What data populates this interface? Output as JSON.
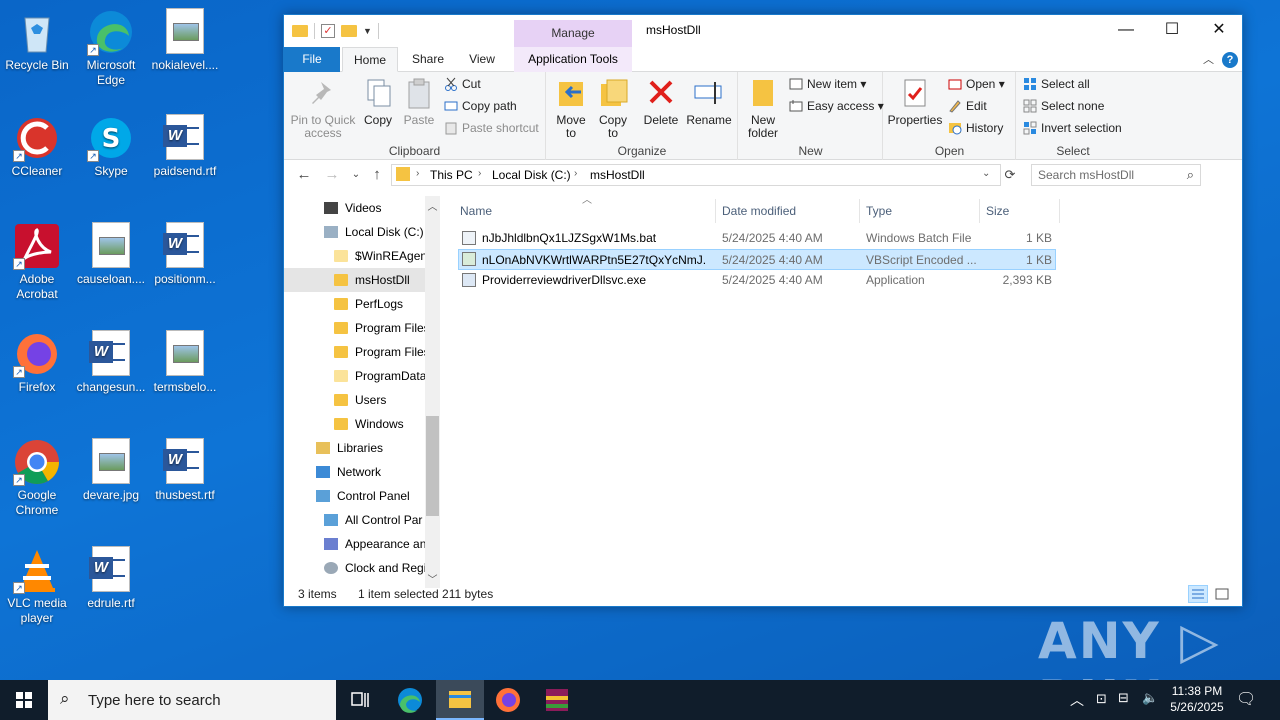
{
  "desktop": {
    "icons": [
      {
        "label": "Recycle Bin",
        "icon": "recycle-bin-icon"
      },
      {
        "label": "Microsoft Edge",
        "icon": "edge-icon"
      },
      {
        "label": "nokialevel....",
        "icon": "image-file-icon"
      },
      {
        "label": "CCleaner",
        "icon": "ccleaner-icon"
      },
      {
        "label": "Skype",
        "icon": "skype-icon"
      },
      {
        "label": "paidsend.rtf",
        "icon": "word-file-icon"
      },
      {
        "label": "Adobe Acrobat",
        "icon": "acrobat-icon"
      },
      {
        "label": "causeloan....",
        "icon": "image-file-icon"
      },
      {
        "label": "positionm...",
        "icon": "word-file-icon"
      },
      {
        "label": "Firefox",
        "icon": "firefox-icon"
      },
      {
        "label": "changesun...",
        "icon": "word-file-icon"
      },
      {
        "label": "termsbelo...",
        "icon": "image-file-icon"
      },
      {
        "label": "Google Chrome",
        "icon": "chrome-icon"
      },
      {
        "label": "devare.jpg",
        "icon": "image-file-icon"
      },
      {
        "label": "thusbest.rtf",
        "icon": "word-file-icon"
      },
      {
        "label": "VLC media player",
        "icon": "vlc-icon"
      },
      {
        "label": "edrule.rtf",
        "icon": "word-file-icon"
      }
    ]
  },
  "window": {
    "title": "msHostDll",
    "context_tab": "Manage",
    "tabs": {
      "file": "File",
      "home": "Home",
      "share": "Share",
      "view": "View",
      "app_tools": "Application Tools"
    },
    "controls": {
      "minimize": "—",
      "maximize": "☐",
      "close": "✕"
    }
  },
  "ribbon": {
    "clipboard": {
      "label": "Clipboard",
      "pin": "Pin to Quick access",
      "copy": "Copy",
      "paste": "Paste",
      "cut": "Cut",
      "copy_path": "Copy path",
      "paste_shortcut": "Paste shortcut"
    },
    "organize": {
      "label": "Organize",
      "move_to": "Move to",
      "copy_to": "Copy to",
      "delete": "Delete",
      "rename": "Rename"
    },
    "new": {
      "label": "New",
      "new_folder": "New folder",
      "new_item": "New item",
      "easy_access": "Easy access"
    },
    "open": {
      "label": "Open",
      "properties": "Properties",
      "open": "Open",
      "edit": "Edit",
      "history": "History"
    },
    "select": {
      "label": "Select",
      "select_all": "Select all",
      "select_none": "Select none",
      "invert": "Invert selection"
    }
  },
  "address": {
    "crumbs": [
      "This PC",
      "Local Disk (C:)",
      "msHostDll"
    ],
    "search_placeholder": "Search msHostDll"
  },
  "nav_pane": {
    "items": [
      {
        "label": "Videos",
        "icon": "videos-folder-icon"
      },
      {
        "label": "Local Disk (C:)",
        "icon": "drive-icon"
      },
      {
        "label": "$WinREAgent",
        "icon": "folder-icon"
      },
      {
        "label": "msHostDll",
        "icon": "folder-icon",
        "selected": true
      },
      {
        "label": "PerfLogs",
        "icon": "folder-icon"
      },
      {
        "label": "Program Files",
        "icon": "folder-icon"
      },
      {
        "label": "Program Files",
        "icon": "folder-icon"
      },
      {
        "label": "ProgramData",
        "icon": "folder-icon"
      },
      {
        "label": "Users",
        "icon": "folder-icon"
      },
      {
        "label": "Windows",
        "icon": "folder-icon"
      },
      {
        "label": "Libraries",
        "icon": "libraries-icon"
      },
      {
        "label": "Network",
        "icon": "network-icon"
      },
      {
        "label": "Control Panel",
        "icon": "control-panel-icon"
      },
      {
        "label": "All Control Par",
        "icon": "control-panel-icon"
      },
      {
        "label": "Appearance an",
        "icon": "appearance-icon"
      },
      {
        "label": "Clock and Regi",
        "icon": "clock-icon"
      }
    ]
  },
  "file_list": {
    "columns": [
      "Name",
      "Date modified",
      "Type",
      "Size"
    ],
    "rows": [
      {
        "name": "nJbJhldlbnQx1LJZSgxW1Ms.bat",
        "date": "5/24/2025 4:40 AM",
        "type": "Windows Batch File",
        "size": "1 KB"
      },
      {
        "name": "nLOnAbNVKWrtlWARPtn5E27tQxYcNmJ...",
        "date": "5/24/2025 4:40 AM",
        "type": "VBScript Encoded ...",
        "size": "1 KB",
        "selected": true
      },
      {
        "name": "ProviderreviewdriverDllsvc.exe",
        "date": "5/24/2025 4:40 AM",
        "type": "Application",
        "size": "2,393 KB"
      }
    ]
  },
  "status": {
    "count": "3 items",
    "selection": "1 item selected  211 bytes"
  },
  "taskbar": {
    "search_placeholder": "Type here to search",
    "time": "11:38 PM",
    "date": "5/26/2025"
  },
  "watermark": "ANY ▷ RUN",
  "colors": {
    "accent": "#1979ca",
    "selection": "#cce8ff",
    "desktop": "#0e74d6",
    "taskbar": "#101d2b"
  }
}
